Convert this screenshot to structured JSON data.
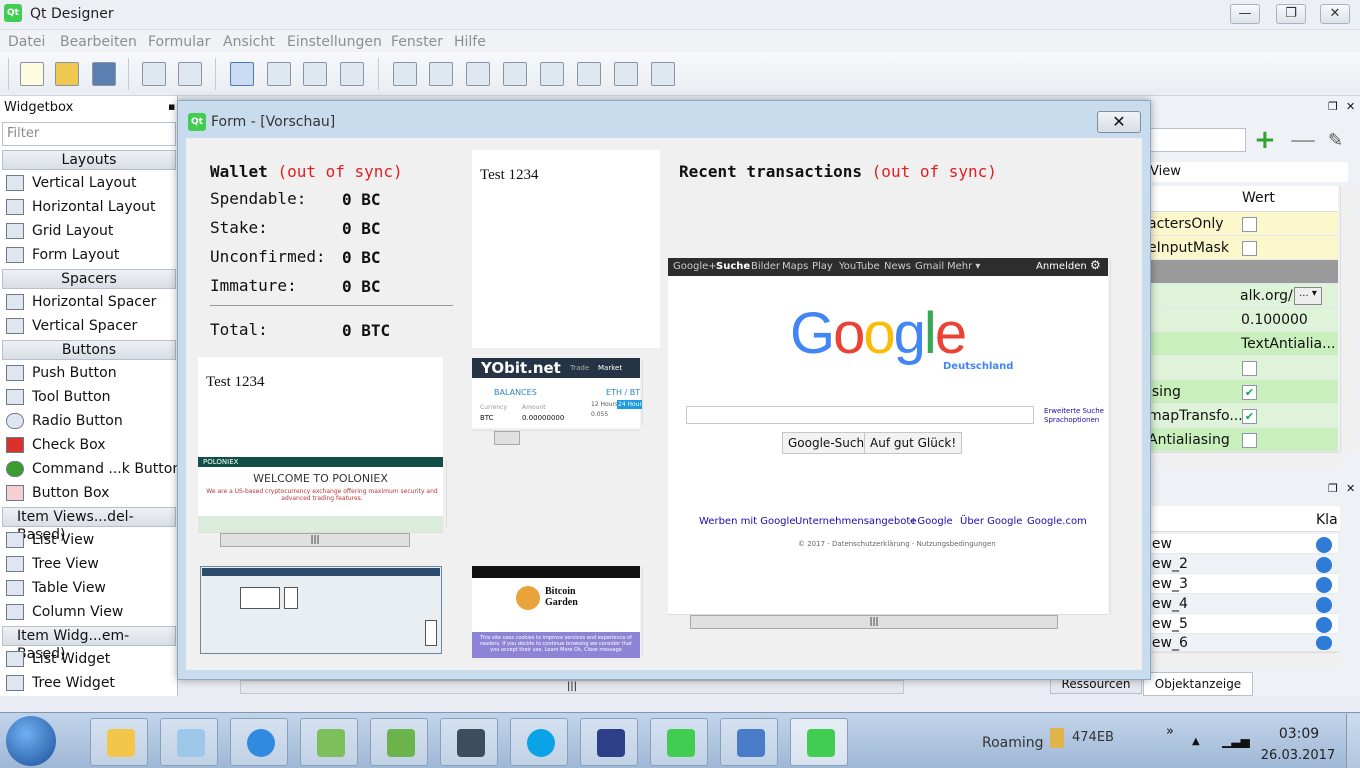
{
  "window": {
    "title": "Qt Designer",
    "minimize": "—",
    "restore": "❐",
    "close": "✕"
  },
  "menu": [
    "Datei",
    "Bearbeiten",
    "Formular",
    "Ansicht",
    "Einstellungen",
    "Fenster",
    "Hilfe"
  ],
  "widgetbox": {
    "title": "Widgetbox",
    "filter_placeholder": "Filter",
    "categories": {
      "layouts": "Layouts",
      "spacers": "Spacers",
      "buttons": "Buttons",
      "item_views": "Item Views...del-Based)",
      "item_widgets": "Item Widg...em-Based)"
    },
    "items": {
      "vertical_layout": "Vertical Layout",
      "horizontal_layout": "Horizontal Layout",
      "grid_layout": "Grid Layout",
      "form_layout": "Form Layout",
      "horizontal_spacer": "Horizontal Spacer",
      "vertical_spacer": "Vertical Spacer",
      "push_button": "Push Button",
      "tool_button": "Tool Button",
      "radio_button": "Radio Button",
      "check_box": "Check Box",
      "command_link": "Command ...k Button",
      "button_box": "Button Box",
      "list_view": "List View",
      "tree_view": "Tree View",
      "table_view": "Table View",
      "column_view": "Column View",
      "list_widget": "List Widget",
      "tree_widget": "Tree Widget"
    }
  },
  "form": {
    "title": "Form - [Vorschau]",
    "wallet": {
      "heading": "Wallet",
      "out_of_sync": "(out of sync)",
      "spendable_label": "Spendable:",
      "spendable_value": "0 BC",
      "stake_label": "Stake:",
      "stake_value": "0 BC",
      "unconfirmed_label": "Unconfirmed:",
      "unconfirmed_value": "0 BC",
      "immature_label": "Immature:",
      "immature_value": "0 BC",
      "total_label": "Total:",
      "total_value": "0 BTC"
    },
    "test_text_1": "Test 1234",
    "test_text_2": "Test 1234",
    "recent": {
      "heading": "Recent transactions",
      "out_of_sync": "(out of sync)"
    },
    "yobit": {
      "logo": "YObit.net",
      "trade": "Trade",
      "market": "Market",
      "balances": "BALANCES",
      "currency": "Currency",
      "amount": "Amount",
      "btc": "BTC",
      "btc_amount": "0.00000000",
      "eth": "ETH / BT",
      "hours12": "12 Hours",
      "hours24": "24 Hour",
      "val": "0.055"
    },
    "poloniex": {
      "brand": "POLONIEX",
      "welcome": "WELCOME TO POLONIEX",
      "sub": "We are a US-based cryptocurrency exchange offering maximum security and advanced trading features."
    },
    "bitcoin_garden": {
      "name": "Bitcoin Garden",
      "cookie": "This site uses cookies to improve services and experience of readers. If you decide to continue browsing we consider that you accept their use.  Learn More    Ok, Close message"
    },
    "google": {
      "bar_links": [
        "Google+",
        "Suche",
        "Bilder",
        "Maps",
        "Play",
        "YouTube",
        "News",
        "Gmail",
        "Mehr ▾"
      ],
      "signin": "Anmelden",
      "logo_country": "Deutschland",
      "advanced": "Erweiterte Suche",
      "language": "Sprachoptionen",
      "search_button": "Google-Suche",
      "lucky_button": "Auf gut Glück!",
      "footer_links": [
        "Werben mit Google",
        "Unternehmensangebote",
        "+Google",
        "Über Google",
        "Google.com"
      ],
      "copyright": "© 2017 - Datenschutzerklärung - Nutzungsbedingungen"
    }
  },
  "property_panel": {
    "col_view": "View",
    "col_value": "Wert",
    "rows": [
      "actersOnly",
      "eInputMask",
      "",
      "alk.org/",
      "0.100000",
      "TextAntialia...",
      "",
      "ising",
      "mapTransfo...",
      "Antialiasing"
    ],
    "url_value": "alk.org/",
    "number_value": "0.100000",
    "hint_value": "TextAntialia..."
  },
  "object_panel": {
    "col_class": "Kla",
    "rows": [
      "iew",
      "iew_2",
      "iew_3",
      "iew_4",
      "iew_5",
      "iew_6"
    ]
  },
  "tabs": {
    "resources": "Ressourcen",
    "object_inspector": "Objektanzeige"
  },
  "taskbar": {
    "roaming": "Roaming",
    "folder": "474EB",
    "time": "03:09",
    "date": "26.03.2017"
  }
}
